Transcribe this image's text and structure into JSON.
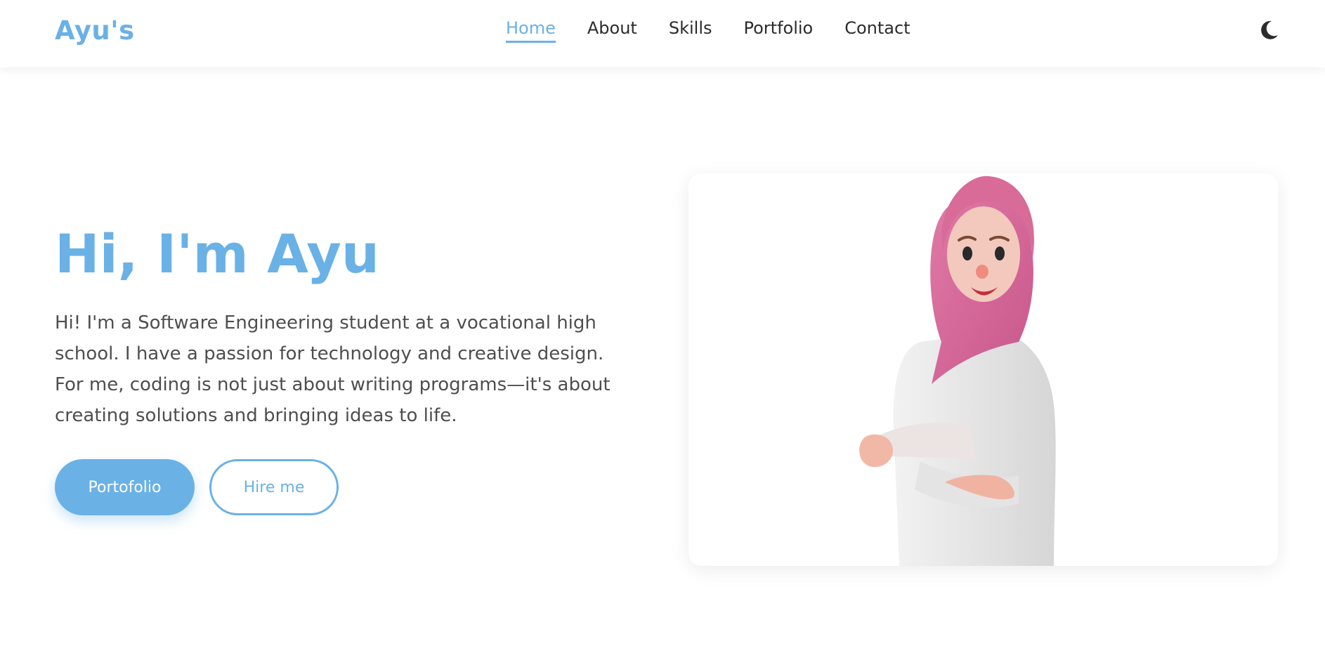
{
  "brand": {
    "logo_text": "Ayu's",
    "accent_color": "#6ab1e6"
  },
  "nav": {
    "items": [
      {
        "label": "Home",
        "active": true
      },
      {
        "label": "About",
        "active": false
      },
      {
        "label": "Skills",
        "active": false
      },
      {
        "label": "Portfolio",
        "active": false
      },
      {
        "label": "Contact",
        "active": false
      }
    ],
    "theme_toggle_icon": "moon-icon"
  },
  "hero": {
    "title": "Hi, I'm Ayu",
    "description": "Hi! I'm a Software Engineering student at a vocational high school. I have a passion for technology and creative design. For me, coding is not just about writing programs—it's about creating solutions and bringing ideas to life.",
    "primary_button": "Portofolio",
    "secondary_button": "Hire me",
    "illustration": "3d-avatar-girl-pink-hijab"
  }
}
